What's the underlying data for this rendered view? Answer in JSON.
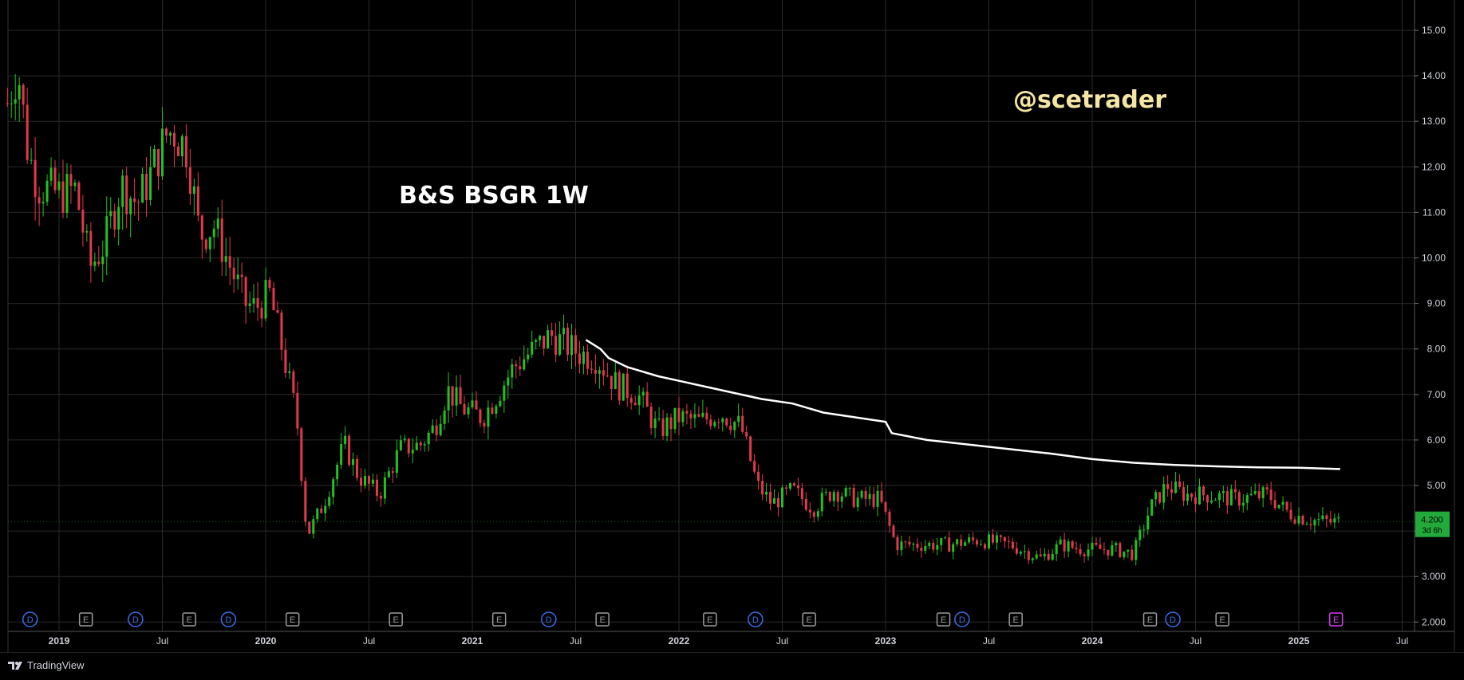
{
  "app": {
    "brand": "TradingView"
  },
  "chart_data": {
    "type": "candlestick",
    "title": "B&S BSGR 1W",
    "watermark": "@scetrader",
    "interval": "1W",
    "y_range": [
      1.8,
      15.2
    ],
    "y_ticks": [
      "15.00",
      "14.00",
      "13.00",
      "12.00",
      "11.00",
      "10.00",
      "9.00",
      "8.00",
      "7.00",
      "6.00",
      "5.00",
      "4.00",
      "3.000",
      "2.000"
    ],
    "x_labels": [
      {
        "label": "2019",
        "t": 2019.0
      },
      {
        "label": "Jul",
        "t": 2019.5
      },
      {
        "label": "2020",
        "t": 2020.0
      },
      {
        "label": "Jul",
        "t": 2020.5
      },
      {
        "label": "2021",
        "t": 2021.0
      },
      {
        "label": "Jul",
        "t": 2021.5
      },
      {
        "label": "2022",
        "t": 2022.0
      },
      {
        "label": "Jul",
        "t": 2022.5
      },
      {
        "label": "2023",
        "t": 2023.0
      },
      {
        "label": "Jul",
        "t": 2023.5
      },
      {
        "label": "2024",
        "t": 2024.0
      },
      {
        "label": "Jul",
        "t": 2024.5
      },
      {
        "label": "2025",
        "t": 2025.0
      },
      {
        "label": "Jul",
        "t": 2025.5
      }
    ],
    "x_range": [
      2018.75,
      2025.6
    ],
    "price_anchors": [
      [
        2018.75,
        13.4
      ],
      [
        2018.8,
        14.2
      ],
      [
        2018.85,
        12.3
      ],
      [
        2018.9,
        11.6
      ],
      [
        2019.0,
        11.4
      ],
      [
        2019.08,
        11.5
      ],
      [
        2019.15,
        9.8
      ],
      [
        2019.22,
        10.3
      ],
      [
        2019.3,
        11.6
      ],
      [
        2019.38,
        11.2
      ],
      [
        2019.45,
        11.9
      ],
      [
        2019.52,
        12.7
      ],
      [
        2019.55,
        12.8
      ],
      [
        2019.62,
        12.4
      ],
      [
        2019.68,
        10.5
      ],
      [
        2019.75,
        10.7
      ],
      [
        2019.82,
        9.9
      ],
      [
        2019.9,
        9.0
      ],
      [
        2019.95,
        8.9
      ],
      [
        2020.02,
        9.2
      ],
      [
        2020.08,
        8.0
      ],
      [
        2020.15,
        6.5
      ],
      [
        2020.2,
        3.9
      ],
      [
        2020.28,
        4.6
      ],
      [
        2020.38,
        5.9
      ],
      [
        2020.45,
        5.2
      ],
      [
        2020.55,
        4.8
      ],
      [
        2020.65,
        5.8
      ],
      [
        2020.75,
        5.9
      ],
      [
        2020.82,
        6.3
      ],
      [
        2020.88,
        7.1
      ],
      [
        2020.95,
        6.7
      ],
      [
        2021.05,
        6.5
      ],
      [
        2021.12,
        7.0
      ],
      [
        2021.2,
        7.6
      ],
      [
        2021.3,
        8.0
      ],
      [
        2021.38,
        8.3
      ],
      [
        2021.45,
        8.1
      ],
      [
        2021.52,
        7.9
      ],
      [
        2021.6,
        7.8
      ],
      [
        2021.7,
        7.2
      ],
      [
        2021.8,
        7.0
      ],
      [
        2021.9,
        6.2
      ],
      [
        2022.0,
        6.5
      ],
      [
        2022.1,
        6.4
      ],
      [
        2022.2,
        6.6
      ],
      [
        2022.3,
        6.3
      ],
      [
        2022.38,
        5.0
      ],
      [
        2022.45,
        4.6
      ],
      [
        2022.55,
        4.9
      ],
      [
        2022.65,
        4.5
      ],
      [
        2022.75,
        4.9
      ],
      [
        2022.85,
        4.7
      ],
      [
        2022.97,
        4.7
      ],
      [
        2023.05,
        3.7
      ],
      [
        2023.15,
        3.7
      ],
      [
        2023.3,
        3.7
      ],
      [
        2023.45,
        3.8
      ],
      [
        2023.6,
        3.7
      ],
      [
        2023.75,
        3.4
      ],
      [
        2023.85,
        3.7
      ],
      [
        2023.95,
        3.6
      ],
      [
        2024.1,
        3.6
      ],
      [
        2024.2,
        3.5
      ],
      [
        2024.28,
        4.5
      ],
      [
        2024.36,
        5.0
      ],
      [
        2024.45,
        4.8
      ],
      [
        2024.55,
        4.8
      ],
      [
        2024.7,
        4.7
      ],
      [
        2024.85,
        4.8
      ],
      [
        2024.95,
        4.4
      ],
      [
        2025.05,
        4.25
      ],
      [
        2025.15,
        4.2
      ],
      [
        2025.2,
        4.2
      ]
    ],
    "moving_average": {
      "color": "#ffffff",
      "points": [
        [
          2021.55,
          8.2
        ],
        [
          2021.62,
          8.0
        ],
        [
          2021.66,
          7.8
        ],
        [
          2021.75,
          7.6
        ],
        [
          2021.9,
          7.4
        ],
        [
          2022.0,
          7.3
        ],
        [
          2022.2,
          7.1
        ],
        [
          2022.4,
          6.9
        ],
        [
          2022.55,
          6.8
        ],
        [
          2022.7,
          6.6
        ],
        [
          2022.85,
          6.5
        ],
        [
          2023.0,
          6.4
        ],
        [
          2023.03,
          6.15
        ],
        [
          2023.2,
          6.0
        ],
        [
          2023.5,
          5.85
        ],
        [
          2023.8,
          5.7
        ],
        [
          2024.0,
          5.58
        ],
        [
          2024.2,
          5.5
        ],
        [
          2024.4,
          5.45
        ],
        [
          2024.6,
          5.42
        ],
        [
          2024.8,
          5.4
        ],
        [
          2025.0,
          5.39
        ],
        [
          2025.2,
          5.36
        ]
      ]
    },
    "last_price": {
      "value": "4.200",
      "countdown": "3d 6h",
      "color": "#22ab3a"
    },
    "up_color": "#22c122",
    "down_color": "#e2394a",
    "event_markers": [
      {
        "type": "D",
        "t": 2018.86
      },
      {
        "type": "E",
        "t": 2019.13
      },
      {
        "type": "D",
        "t": 2019.37
      },
      {
        "type": "E",
        "t": 2019.63
      },
      {
        "type": "D",
        "t": 2019.82
      },
      {
        "type": "E",
        "t": 2020.13
      },
      {
        "type": "E",
        "t": 2020.63
      },
      {
        "type": "E",
        "t": 2021.13
      },
      {
        "type": "D",
        "t": 2021.37
      },
      {
        "type": "E",
        "t": 2021.63
      },
      {
        "type": "E",
        "t": 2022.15
      },
      {
        "type": "D",
        "t": 2022.37
      },
      {
        "type": "E",
        "t": 2022.63
      },
      {
        "type": "E",
        "t": 2023.28
      },
      {
        "type": "D",
        "t": 2023.37
      },
      {
        "type": "E",
        "t": 2023.63
      },
      {
        "type": "E",
        "t": 2024.28
      },
      {
        "type": "D",
        "t": 2024.39
      },
      {
        "type": "E",
        "t": 2024.63
      },
      {
        "type": "E",
        "t": 2025.18
      }
    ]
  }
}
